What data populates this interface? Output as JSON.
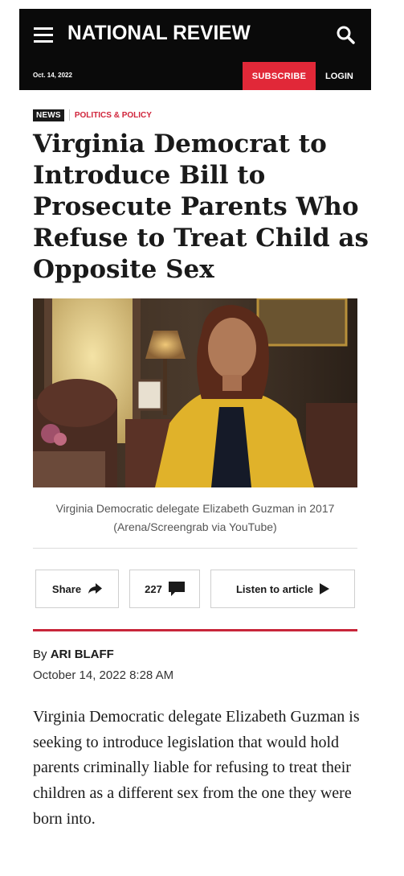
{
  "header": {
    "logo": "NATIONAL REVIEW",
    "date": "Oct. 14, 2022",
    "subscribe_label": "SUBSCRIBE",
    "login_label": "LOGIN",
    "menu_icon": "hamburger-menu-icon",
    "search_icon": "search-icon",
    "background": "#0a0a0a",
    "accent": "#e12838"
  },
  "article": {
    "tag_primary": "NEWS",
    "tag_category": "POLITICS & POLICY",
    "headline": "Virginia Democrat to Introduce Bill to Prosecute Parents Who Refuse to Treat Child as Opposite Sex",
    "caption_line1": "Virginia Democratic delegate Elizabeth Guzman in 2017",
    "caption_line2": "(Arena/Screengrab via YouTube)",
    "actions": {
      "share_label": "Share",
      "share_icon": "share-arrow-icon",
      "comment_count": "227",
      "comment_icon": "comment-bubble-icon",
      "listen_label": "Listen to article",
      "listen_icon": "play-icon"
    },
    "byline_prefix": "By",
    "author": "ARI BLAFF",
    "published": "October 14, 2022 8:28 AM",
    "body": "Virginia Democratic delegate Elizabeth Guzman is seeking to introduce legislation that would hold parents criminally liable for refusing to treat their children as a different sex from the one they were born into."
  }
}
